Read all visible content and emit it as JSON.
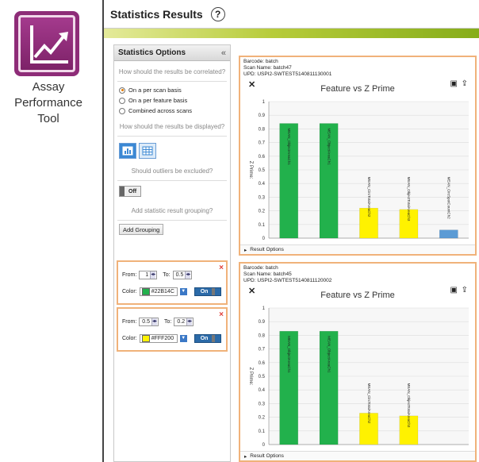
{
  "app_icon": {
    "icon": "chart-trend-icon",
    "caption_line1": "Assay",
    "caption_line2": "Performance",
    "caption_line3": "Tool",
    "color": "#8e2c78"
  },
  "window": {
    "title": "Statistics Results",
    "help_glyph": "?"
  },
  "left_panel": {
    "title": "Statistics Options",
    "collapse_glyph": "«",
    "q_correlated": "How should the results be correlated?",
    "radio_options": [
      "On a per scan basis",
      "On a per feature basis",
      "Combined across scans"
    ],
    "radio_selected": 0,
    "q_displayed": "How should the results be displayed?",
    "view_buttons": [
      "chart-view-icon",
      "table-view-icon"
    ],
    "q_outliers": "Should outliers be excluded?",
    "outliers_toggle": "Off",
    "q_grouping": "Add statistic result grouping?",
    "add_grouping_label": "Add Grouping",
    "groupings": [
      {
        "from_label": "From:",
        "from": "1",
        "to_label": "To:",
        "to": "0.5",
        "color_label": "Color:",
        "color": "#22B14C",
        "toggle": "On",
        "close": "×"
      },
      {
        "from_label": "From:",
        "from": "0.5",
        "to_label": "To:",
        "to": "0.2",
        "color_label": "Color:",
        "color": "#FFF200",
        "toggle": "On",
        "close": "×"
      }
    ]
  },
  "cards": [
    {
      "barcode": "Barcode: batch",
      "scan_name": "Scan Name: batch47",
      "upd": "UPD: USPI2-SWTEST5140811130001",
      "footer": "Result Options"
    },
    {
      "barcode": "Barcode: batch",
      "scan_name": "Scan Name: batch45",
      "upd": "UPD: USPI2-SWTEST5140811120002",
      "footer": "Result Options"
    }
  ],
  "chart_data": [
    {
      "type": "bar",
      "title": "Feature vs Z Prime",
      "ylabel": "Z Prime",
      "ylim": [
        0,
        1
      ],
      "yticks": [
        "0",
        "0.1",
        "0.2",
        "0.3",
        "0.4",
        "0.5",
        "0.6",
        "0.7",
        "0.8",
        "0.9",
        "1"
      ],
      "grid": true,
      "categories": [
        "MEAN_ObjectAreaCh1",
        "MEAN_ObjectAreaCh1",
        "MEAN_CircTotalAreaCh2",
        "MEAN_ObjectTotalAreaCh3",
        "MEAN_CircSpotCountCh2"
      ],
      "values": [
        0.84,
        0.84,
        0.22,
        0.21,
        0.06
      ],
      "colors": [
        "#22B14C",
        "#22B14C",
        "#FFF200",
        "#FFF200",
        "#5b9bd5"
      ]
    },
    {
      "type": "bar",
      "title": "Feature vs Z Prime",
      "ylabel": "Z Prime",
      "ylim": [
        0,
        1
      ],
      "yticks": [
        "0",
        "0.1",
        "0.2",
        "0.3",
        "0.4",
        "0.5",
        "0.6",
        "0.7",
        "0.8",
        "0.9",
        "1"
      ],
      "grid": true,
      "categories": [
        "MEAN_ObjectAreaCh1",
        "MEAN_ObjectAreaCh1",
        "MEAN_CircTotalAreaCh2",
        "MEAN_ObjectTotalAreaCh3"
      ],
      "values": [
        0.83,
        0.83,
        0.23,
        0.21
      ],
      "colors": [
        "#22B14C",
        "#22B14C",
        "#FFF200",
        "#FFF200"
      ]
    }
  ]
}
